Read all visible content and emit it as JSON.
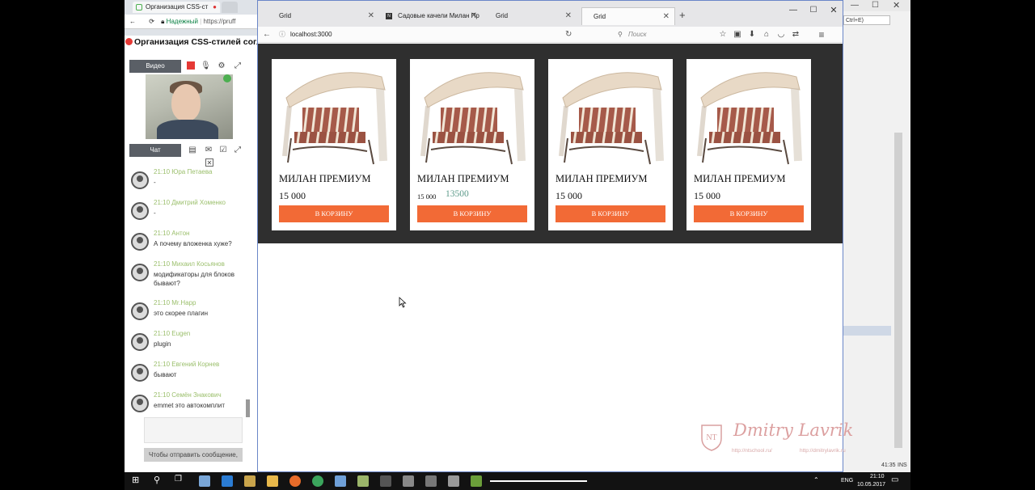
{
  "bg_browser": {
    "tab1": "Организация CSS-ст",
    "address_secure": "Надежный",
    "address_url": "https://pruff"
  },
  "webinar": {
    "title": "Организация CSS-стилей согласн",
    "video_label": "Видео",
    "chat_label": "Чат",
    "messages": [
      {
        "meta": "21:10 Юра Петаева",
        "text": "-"
      },
      {
        "meta": "21:10 Дмитрий Хоменко",
        "text": "-"
      },
      {
        "meta": "21:10 Антон",
        "text": "А почему вложенка хуже?"
      },
      {
        "meta": "21:10 Михаил Косьянов",
        "text": "модификаторы для блоков бывают?"
      },
      {
        "meta": "21:10 Mr.Happ",
        "text": "это скорее плагин"
      },
      {
        "meta": "21:10 Eugen",
        "text": "plugin"
      },
      {
        "meta": "21:10 Евгений Корнев",
        "text": "бывают"
      },
      {
        "meta": "21:10 Семён Знакович",
        "text": "emmet это автокомплит"
      }
    ],
    "send_label": "Чтобы отправить сообщение,"
  },
  "ide": {
    "shortcut": "Ctrl+E)",
    "status_time": "41:35",
    "status_mode": "INS"
  },
  "firefox": {
    "tabs": [
      {
        "label": "Grid",
        "favicon": ""
      },
      {
        "label": "Садовые качели Милан Пр",
        "favicon": "N"
      },
      {
        "label": "Grid",
        "favicon": ""
      },
      {
        "label": "Grid",
        "favicon": ""
      }
    ],
    "new_tab": "+",
    "url": "localhost:3000",
    "search_placeholder": "Поиск",
    "icons": [
      "back-icon",
      "info-icon",
      "reload-icon",
      "search-icon",
      "bookmark-star-icon",
      "library-icon",
      "download-icon",
      "home-icon",
      "pocket-icon",
      "sync-icon",
      "menu-icon"
    ]
  },
  "products": [
    {
      "name": "МИЛАН ПРЕМИУМ",
      "price": "15 000",
      "sale": "",
      "button": "В КОРЗИНУ"
    },
    {
      "name": "МИЛАН ПРЕМИУМ",
      "price": "15 000",
      "sale": "13500",
      "button": "В КОРЗИНУ"
    },
    {
      "name": "МИЛАН ПРЕМИУМ",
      "price": "15 000",
      "sale": "",
      "button": "В КОРЗИНУ"
    },
    {
      "name": "МИЛАН ПРЕМИУМ",
      "price": "15 000",
      "sale": "",
      "button": "В КОРЗИНУ"
    }
  ],
  "watermark": {
    "name": "Dmitry Lavrik",
    "badge": "NT",
    "site1": "http://ntschool.ru/",
    "site2": "http://dmitrylavrik.ru"
  },
  "taskbar": {
    "lang": "ENG",
    "time": "21:10",
    "date": "10.05.2017"
  },
  "colors": {
    "accent_orange": "#f26a36",
    "sale_green": "#5d9b8a",
    "grid_bg": "#2f2f2f"
  }
}
